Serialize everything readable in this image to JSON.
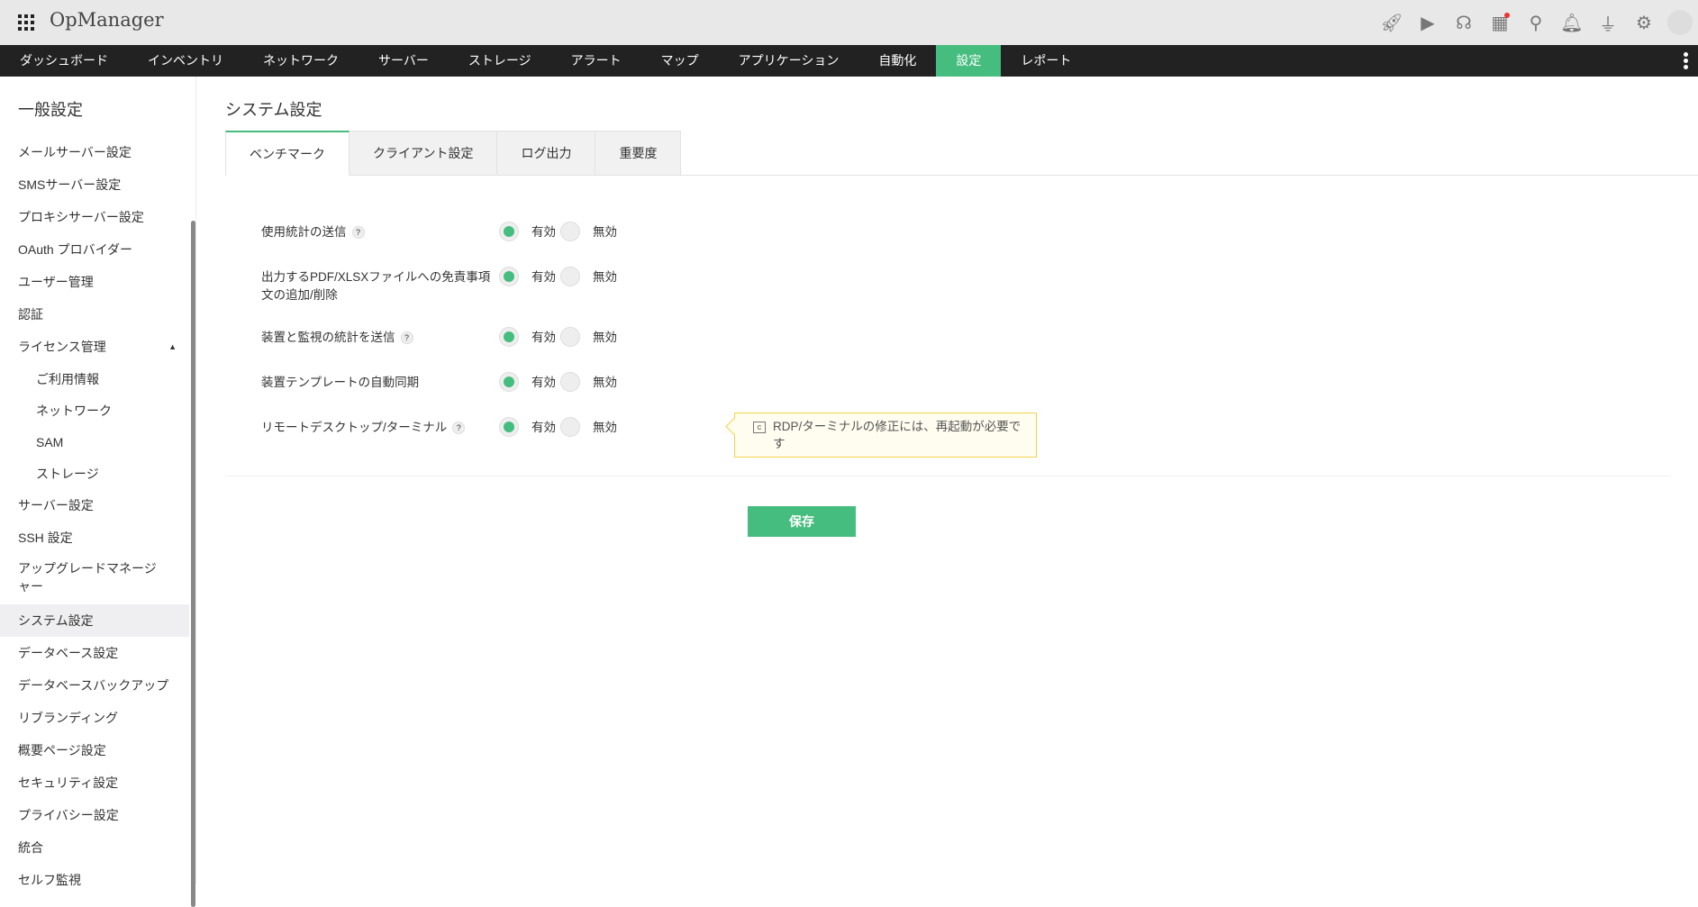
{
  "header": {
    "app_title": "OpManager",
    "icons": [
      "rocket-icon",
      "presentation-icon",
      "headset-icon",
      "gift-icon",
      "search-icon",
      "bell-icon",
      "plug-icon",
      "gear-icon",
      "avatar"
    ]
  },
  "nav": {
    "items": [
      "ダッシュボード",
      "インベントリ",
      "ネットワーク",
      "サーバー",
      "ストレージ",
      "アラート",
      "マップ",
      "アプリケーション",
      "自動化",
      "設定",
      "レポート"
    ],
    "active": "設定"
  },
  "sidebar": {
    "title": "一般設定",
    "items": [
      "メールサーバー設定",
      "SMSサーバー設定",
      "プロキシサーバー設定",
      "OAuth プロバイダー",
      "ユーザー管理",
      "認証",
      "ライセンス管理",
      "ご利用情報",
      "ネットワーク",
      "SAM",
      "ストレージ",
      "サーバー設定",
      "SSH 設定",
      "アップグレードマネージャー",
      "システム設定",
      "データベース設定",
      "データベースバックアップ",
      "リブランディング",
      "概要ページ設定",
      "セキュリティ設定",
      "プライバシー設定",
      "統合",
      "セルフ監視"
    ]
  },
  "main": {
    "title": "システム設定",
    "tabs": [
      "ベンチマーク",
      "クライアント設定",
      "ログ出力",
      "重要度"
    ],
    "settings": [
      {
        "label": "使用統計の送信",
        "help": "?",
        "value": "有効"
      },
      {
        "label": "出力するPDF/XLSXファイルへの免責事項文の追加/削除",
        "value": "有効"
      },
      {
        "label": "装置と監視の統計を送信",
        "help": "?",
        "value": "有効"
      },
      {
        "label": "装置テンプレートの自動同期",
        "value": "有効"
      },
      {
        "label": "リモートデスクトップ/ターミナル",
        "help": "?",
        "value": "有効"
      }
    ],
    "on_label": "有効",
    "off_label": "無効",
    "tooltip": "RDP/ターミナルの修正には、再起動が必要です",
    "save_label": "保存"
  },
  "colors": {
    "accent": "#45bd7e",
    "nav_bg": "#222222"
  }
}
